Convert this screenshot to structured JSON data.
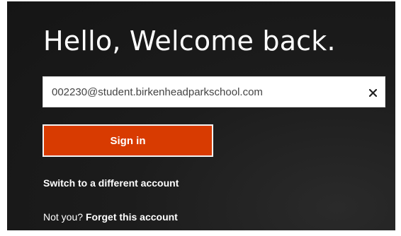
{
  "header": {
    "title": "Hello, Welcome back."
  },
  "account": {
    "email": "002230@student.birkenheadparkschool.com",
    "clear_icon": "close-icon"
  },
  "actions": {
    "sign_in_label": "Sign in",
    "switch_account_label": "Switch to a different account",
    "not_you_label": "Not you?",
    "forget_account_label": "Forget this account"
  },
  "colors": {
    "accent": "#d83b01",
    "background": "#1c1c1c"
  }
}
